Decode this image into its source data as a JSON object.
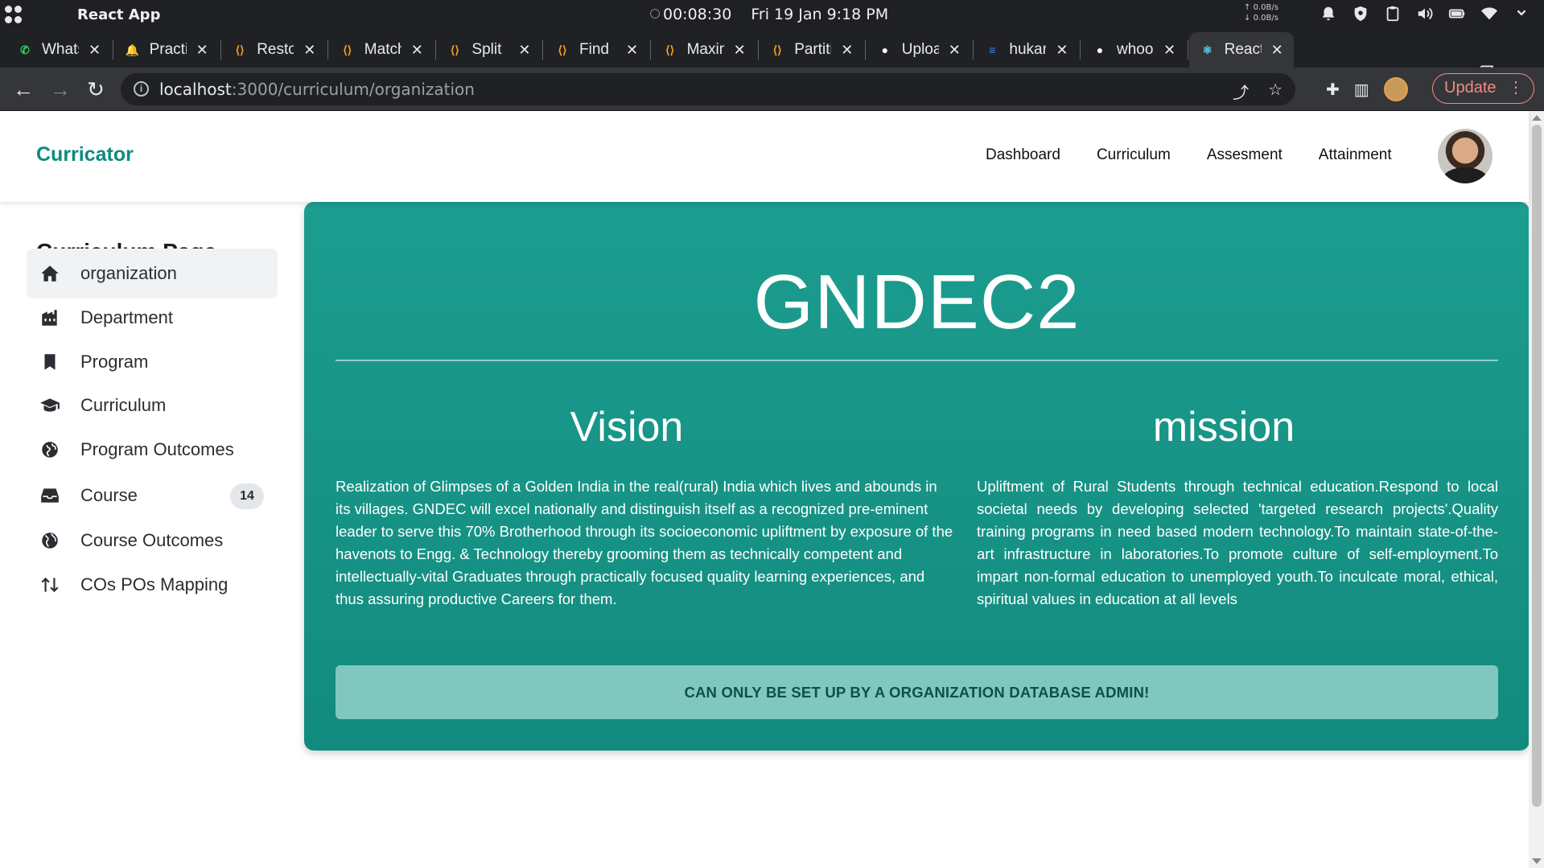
{
  "os": {
    "app_name": "React App",
    "timer": "00:08:30",
    "datetime": "Fri 19 Jan  9:18 PM",
    "net_up": "0.0B/s",
    "net_down": "0.0B/s"
  },
  "browser": {
    "tabs": [
      {
        "title": "WhatsApp",
        "icon": "whatsapp-icon",
        "color": "#25d366"
      },
      {
        "title": "Practice",
        "icon": "bell-icon",
        "color": "#f0b400"
      },
      {
        "title": "Restore",
        "icon": "code-icon",
        "color": "#f89f1b"
      },
      {
        "title": "Match",
        "icon": "code-icon",
        "color": "#f89f1b"
      },
      {
        "title": "Split",
        "icon": "code-icon",
        "color": "#f89f1b"
      },
      {
        "title": "Find",
        "icon": "code-icon",
        "color": "#f89f1b"
      },
      {
        "title": "Maximum",
        "icon": "code-icon",
        "color": "#f89f1b"
      },
      {
        "title": "Partition",
        "icon": "code-icon",
        "color": "#f89f1b"
      },
      {
        "title": "Upload",
        "icon": "github-icon",
        "color": "#ffffff"
      },
      {
        "title": "hukam",
        "icon": "docs-icon",
        "color": "#4285f4"
      },
      {
        "title": "whoo",
        "icon": "github-icon",
        "color": "#ffffff"
      },
      {
        "title": "React App",
        "icon": "react-icon",
        "color": "#61dafb"
      }
    ],
    "url_host": "localhost",
    "url_path": ":3000/curriculum/organization",
    "update_label": "Update"
  },
  "header": {
    "brand": "Curricator",
    "nav": [
      "Dashboard",
      "Curriculum",
      "Assesment",
      "Attainment"
    ],
    "accent_color": "#0f8a80"
  },
  "sidebar": {
    "title": "Curriculum Page",
    "items": [
      {
        "label": "organization",
        "icon": "home-icon",
        "active": true
      },
      {
        "label": "Department",
        "icon": "building-icon"
      },
      {
        "label": "Program",
        "icon": "bookmark-icon"
      },
      {
        "label": "Curriculum",
        "icon": "graduation-cap-icon"
      },
      {
        "label": "Program Outcomes",
        "icon": "globe-icon"
      },
      {
        "label": "Course",
        "icon": "inbox-icon",
        "badge": "14"
      },
      {
        "label": "Course Outcomes",
        "icon": "globe-icon"
      },
      {
        "label": "COs POs Mapping",
        "icon": "swap-vertical-icon"
      }
    ]
  },
  "main": {
    "title": "GNDEC2",
    "vision_heading": "Vision",
    "vision_text": "Realization of Glimpses of a Golden India in the real(rural) India which lives and abounds in its villages. GNDEC will excel nationally and distinguish itself as a recognized pre-eminent leader to serve this 70% Brotherhood through its socioeconomic upliftment by exposure of the havenots to Engg. & Technology thereby grooming them as technically competent and intellectually-vital Graduates through practically focused quality learning experiences, and thus assuring productive Careers for them.",
    "mission_heading": "mission",
    "mission_text": "Upliftment of Rural Students through technical education.Respond to local societal needs by developing selected 'targeted research projects'.Quality training programs in need based modern technology.To maintain state-of-the-art infrastructure in laboratories.To promote culture of self-employment.To impart non-formal education to unemployed youth.To inculcate moral, ethical, spiritual values in education at all levels",
    "admin_notice": "CAN ONLY BE SET UP BY A ORGANIZATION DATABASE ADMIN!",
    "card_color": "#1a9686"
  }
}
